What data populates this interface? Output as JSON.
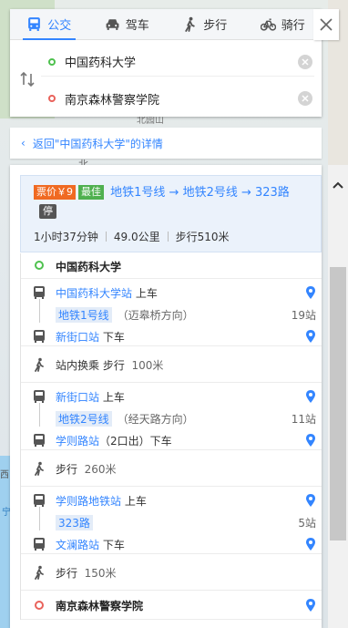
{
  "tabs": [
    {
      "label": "公交",
      "icon": "bus-icon",
      "active": true
    },
    {
      "label": "驾车",
      "icon": "car-icon",
      "active": false
    },
    {
      "label": "步行",
      "icon": "walk-icon",
      "active": false
    },
    {
      "label": "骑行",
      "icon": "bike-icon",
      "active": false
    }
  ],
  "route": {
    "start": "中国药科大学",
    "end": "南京森林警察学院"
  },
  "back_link": "返回\"中国药科大学\"的详情",
  "map_labels": {
    "north": "北",
    "park": "北园山",
    "west": "西",
    "ning": "宁"
  },
  "summary": {
    "price_badge": "票价￥9",
    "best_badge": "最佳",
    "lines": "地铁1号线 → 地铁2号线 → 323路",
    "stop_badge": "停",
    "duration": "1小时37分钟",
    "distance": "49.0公里",
    "walk": "步行510米"
  },
  "steps": {
    "start_place": "中国药科大学",
    "seg1": {
      "board_station": "中国药科大学站",
      "board": "上车",
      "line": "地铁1号线",
      "direction": "（迈皋桥方向）",
      "stops": "19站",
      "alight_station": "新街口站",
      "alight": "下车"
    },
    "transfer1": {
      "text": "站内换乘 步行",
      "dist": "100米"
    },
    "seg2": {
      "board_station": "新街口站",
      "board": "上车",
      "line": "地铁2号线",
      "direction": "（经天路方向）",
      "stops": "11站",
      "alight_station": "学则路站",
      "alight_extra": "（2口出）",
      "alight": "下车"
    },
    "walk2": {
      "text": "步行",
      "dist": "260米"
    },
    "seg3": {
      "board_station": "学则路地铁站",
      "board": "上车",
      "line": "323路",
      "stops": "5站",
      "alight_station": "文澜路站",
      "alight": "下车"
    },
    "walk3": {
      "text": "步行",
      "dist": "150米"
    },
    "end_place": "南京森林警察学院"
  }
}
